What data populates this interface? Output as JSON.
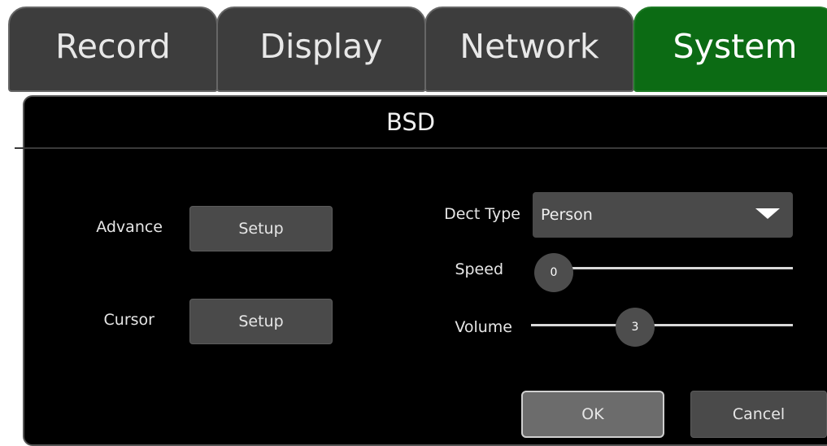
{
  "tabs": [
    {
      "label": "Record",
      "active": false
    },
    {
      "label": "Display",
      "active": false
    },
    {
      "label": "Network",
      "active": false
    },
    {
      "label": "System",
      "active": true
    }
  ],
  "panel": {
    "title": "BSD",
    "advance": {
      "label": "Advance",
      "button": "Setup"
    },
    "cursor": {
      "label": "Cursor",
      "button": "Setup"
    },
    "dect_type": {
      "label": "Dect Type",
      "value": "Person"
    },
    "speed": {
      "label": "Speed",
      "value": "0"
    },
    "volume": {
      "label": "Volume",
      "value": "3"
    },
    "ok_label": "OK",
    "cancel_label": "Cancel"
  },
  "colors": {
    "active_tab": "#0c6b14",
    "inactive_tab": "#3d3d3d",
    "panel_bg": "#000000",
    "control_bg": "#4a4a4a"
  }
}
